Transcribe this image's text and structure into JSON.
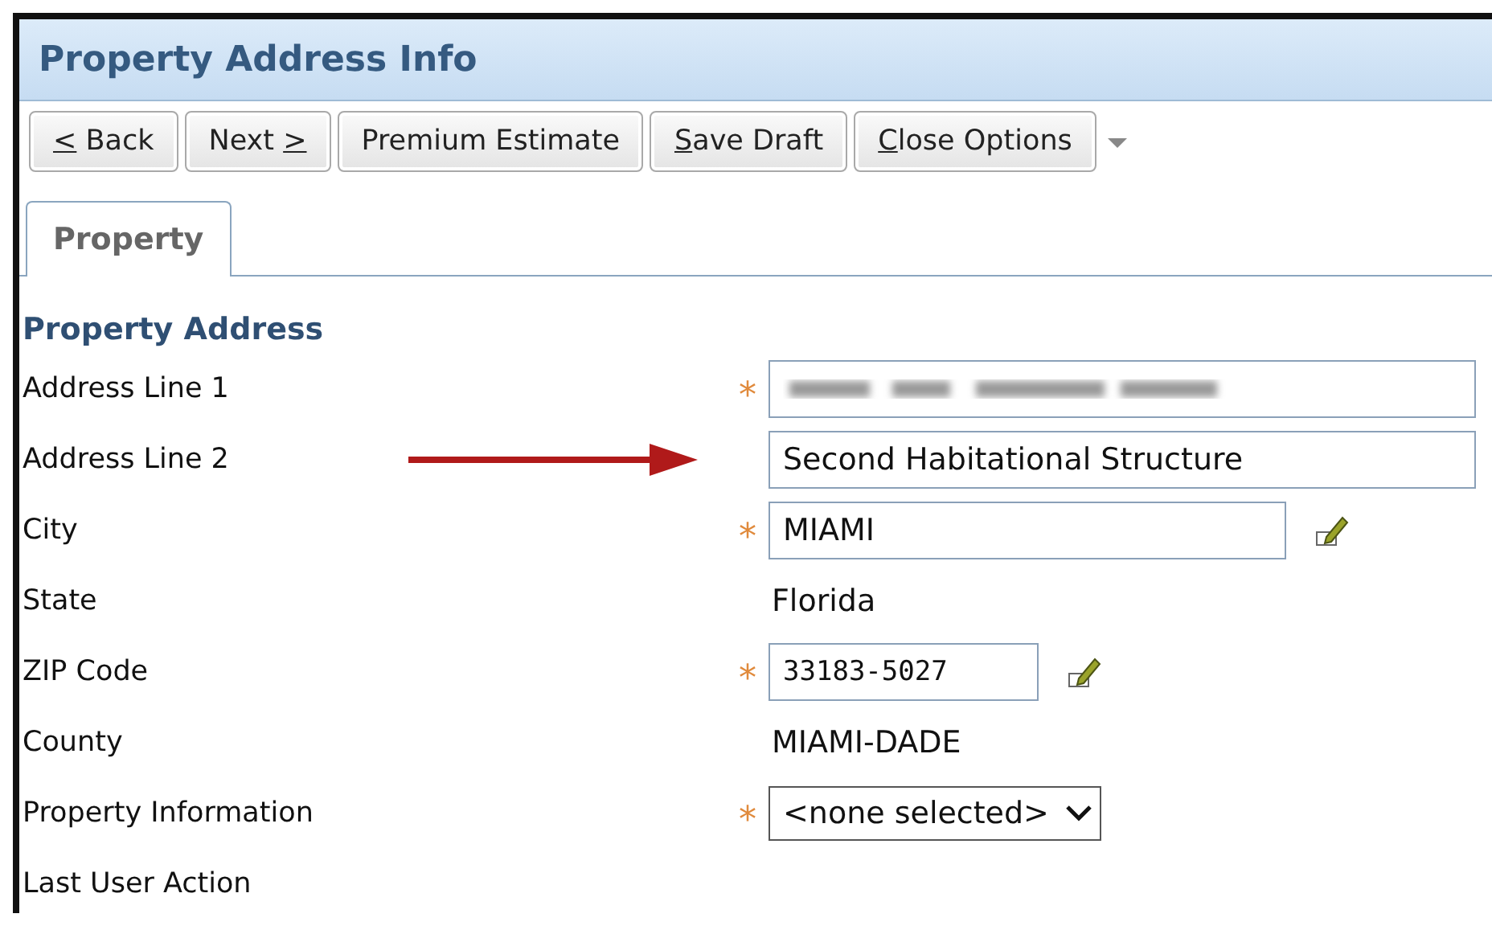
{
  "window": {
    "title": "Property Address Info"
  },
  "toolbar": [
    {
      "parts": [
        {
          "text": "<",
          "underlined": true
        },
        {
          "text": " Back",
          "underlined": false
        }
      ]
    },
    {
      "parts": [
        {
          "text": "Next ",
          "underlined": false
        },
        {
          "text": ">",
          "underlined": true
        }
      ]
    },
    {
      "parts": [
        {
          "text": "Premium Estimate",
          "underlined": false
        }
      ]
    },
    {
      "parts": [
        {
          "text": "S",
          "underlined": true
        },
        {
          "text": "ave Draft",
          "underlined": false
        }
      ]
    },
    {
      "parts": [
        {
          "text": "C",
          "underlined": true
        },
        {
          "text": "lose Options",
          "underlined": false
        }
      ]
    }
  ],
  "tabs": [
    {
      "label": "Property",
      "selected": true
    }
  ],
  "section": {
    "title": "Property Address"
  },
  "fields": [
    {
      "label": "Address Line 1",
      "kind": "redacted",
      "required_mark": "*"
    },
    {
      "label": "Address Line 2",
      "kind": "text",
      "value": "Second Habitational Structure",
      "arrow": true
    },
    {
      "label": "City",
      "kind": "text",
      "value": "MIAMI",
      "required_mark": "*",
      "editable": true
    },
    {
      "label": "State",
      "kind": "static",
      "value": "Florida"
    },
    {
      "label": "ZIP Code",
      "kind": "zip",
      "value": "33183-5027",
      "required_mark": "*",
      "editable": true
    },
    {
      "label": "County",
      "kind": "static",
      "value": "MIAMI-DADE"
    },
    {
      "label": "Property Information",
      "kind": "select",
      "value": "<none selected>",
      "required_mark": "*"
    },
    {
      "label": "Last User Action",
      "kind": "none"
    }
  ]
}
